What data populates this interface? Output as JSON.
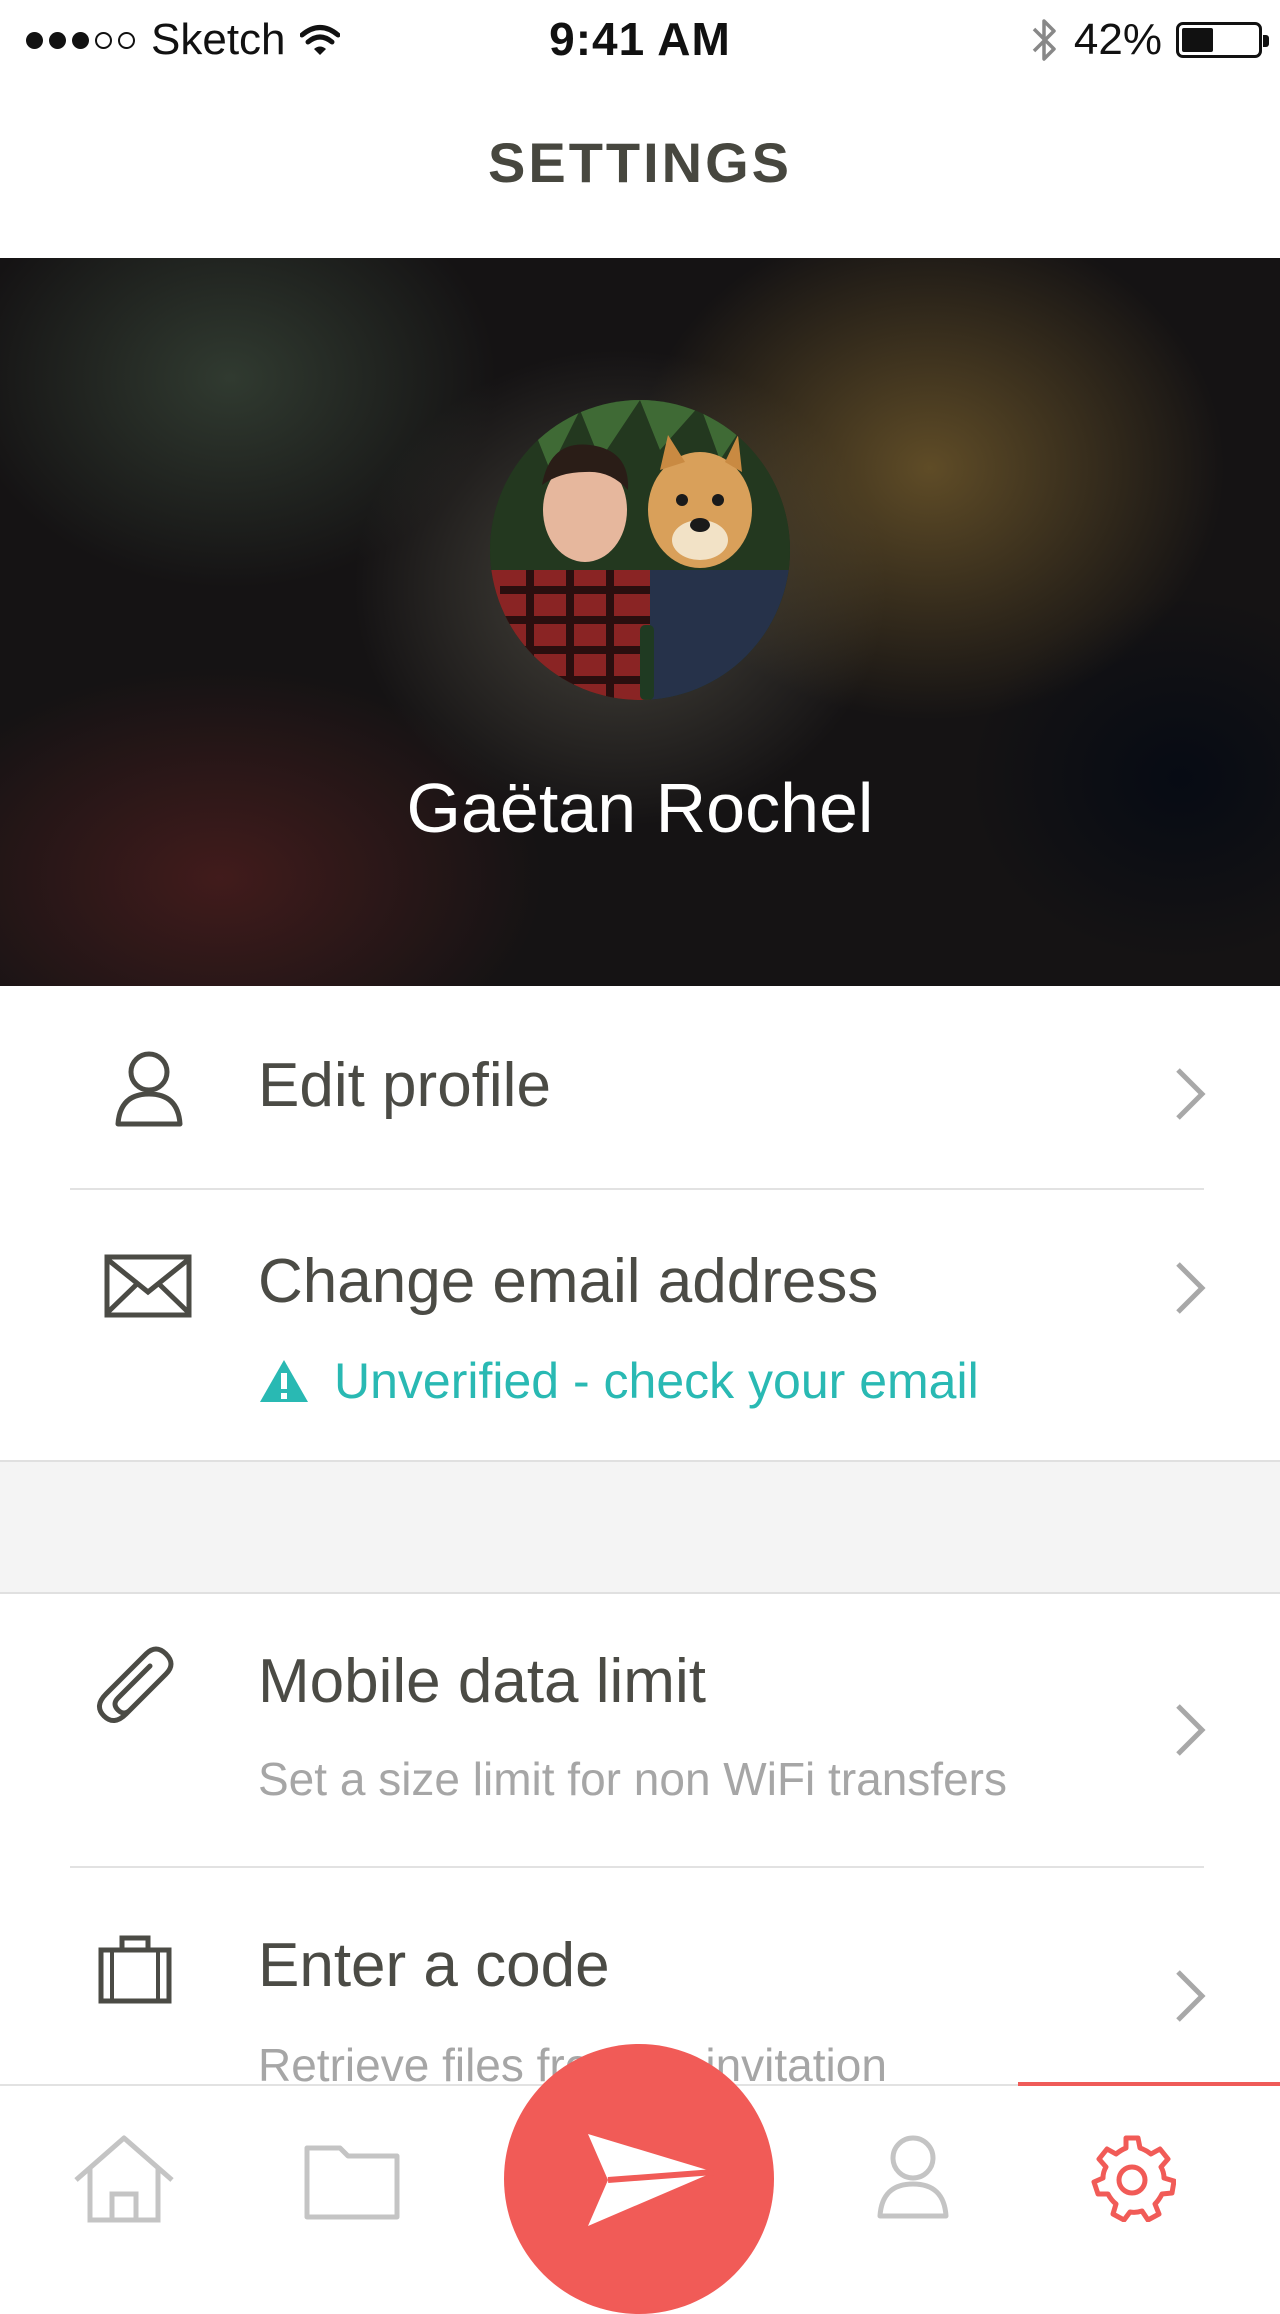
{
  "status_bar": {
    "carrier": "Sketch",
    "time": "9:41 AM",
    "battery_percent": "42%",
    "battery_level": 0.42,
    "signal_bars_filled": 3,
    "signal_bars_total": 5
  },
  "nav": {
    "title": "SETTINGS"
  },
  "profile": {
    "name": "Gaëtan Rochel"
  },
  "settings": {
    "edit_profile": {
      "title": "Edit profile",
      "icon": "person-icon"
    },
    "change_email": {
      "title": "Change email address",
      "icon": "envelope-icon",
      "warning": "Unverified - check your email"
    },
    "mobile_data": {
      "title": "Mobile data limit",
      "subtitle": "Set a size limit for non WiFi transfers",
      "icon": "paperclip-icon"
    },
    "enter_code": {
      "title": "Enter a code",
      "subtitle": "Retrieve files from an invitation",
      "icon": "briefcase-icon"
    }
  },
  "tabbar": {
    "tabs": [
      "home-icon",
      "folder-icon",
      "send-icon",
      "profile-icon",
      "settings-gear-icon"
    ],
    "active_tab": "settings-gear-icon"
  },
  "colors": {
    "accent": "#f15b57",
    "warning": "#29b9b3",
    "text": "#4b4b45",
    "subtext": "#a6a6a6"
  }
}
